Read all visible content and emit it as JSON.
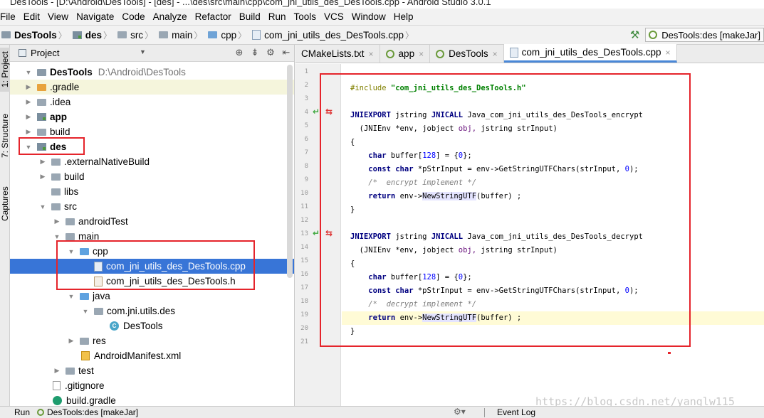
{
  "window": {
    "title": "DesTools - [D:\\Android\\DesTools] - [des] - ...\\des\\src\\main\\cpp\\com_jni_utils_des_DesTools.cpp - Android Studio 3.0.1"
  },
  "menu": [
    "File",
    "Edit",
    "View",
    "Navigate",
    "Code",
    "Analyze",
    "Refactor",
    "Build",
    "Run",
    "Tools",
    "VCS",
    "Window",
    "Help"
  ],
  "breadcrumb": [
    "DesTools",
    "des",
    "src",
    "main",
    "cpp",
    "com_jni_utils_des_DesTools.cpp"
  ],
  "run_config": "DesTools:des [makeJar]",
  "left_tabs": [
    "1: Project",
    "7: Structure",
    "Captures"
  ],
  "project_panel": {
    "title": "Project",
    "tree": [
      {
        "label": "DesTools",
        "path": "D:\\Android\\DesTools"
      },
      {
        "label": ".gradle"
      },
      {
        "label": ".idea"
      },
      {
        "label": "app"
      },
      {
        "label": "build"
      },
      {
        "label": "des"
      },
      {
        "label": ".externalNativeBuild"
      },
      {
        "label": "build"
      },
      {
        "label": "libs"
      },
      {
        "label": "src"
      },
      {
        "label": "androidTest"
      },
      {
        "label": "main"
      },
      {
        "label": "cpp"
      },
      {
        "label": "com_jni_utils_des_DesTools.cpp"
      },
      {
        "label": "com_jni_utils_des_DesTools.h"
      },
      {
        "label": "java"
      },
      {
        "label": "com.jni.utils.des"
      },
      {
        "label": "DesTools"
      },
      {
        "label": "res"
      },
      {
        "label": "AndroidManifest.xml"
      },
      {
        "label": "test"
      },
      {
        "label": ".gitignore"
      },
      {
        "label": "build.gradle"
      }
    ]
  },
  "editor": {
    "tabs": [
      {
        "label": "CMakeLists.txt"
      },
      {
        "label": "app"
      },
      {
        "label": "DesTools"
      },
      {
        "label": "com_jni_utils_des_DesTools.cpp"
      }
    ],
    "line_numbers": [
      "1",
      "2",
      "3",
      "4",
      "5",
      "6",
      "7",
      "8",
      "9",
      "10",
      "11",
      "12",
      "13",
      "14",
      "15",
      "16",
      "17",
      "18",
      "19",
      "20",
      "21"
    ],
    "code": {
      "include_directive": "#include",
      "include_file": "\"com_jni_utils_des_DesTools.h\"",
      "jniexport": "JNIEXPORT",
      "jstring": "jstring",
      "jnicall": "JNICALL",
      "encrypt_fn": "Java_com_jni_utils_des_DesTools_encrypt",
      "decrypt_fn": "Java_com_jni_utils_des_DesTools_decrypt",
      "params_jnienv": "(JNIEnv *env,",
      "params_jobject": "jobject",
      "params_obj": "obj,",
      "params_jstring": "jstring",
      "params_strinput": "strInput)",
      "open_brace": "{",
      "close_brace": "}",
      "char_kw": "char",
      "buffer_decl": "buffer[",
      "buffer_size": "128",
      "buffer_rest": "] = {",
      "zero": "0",
      "buffer_end": "};",
      "const_kw": "const",
      "pstr_decl": "*pStrInput = env->GetStringUTFChars(strInput, ",
      "pstr_end": ");",
      "encrypt_comment": "/*  encrypt implement */",
      "decrypt_comment": "/*  decrypt implement */",
      "return_kw": "return",
      "return_env": "env->",
      "new_string": "NewStringUTF",
      "return_args": "(buffer) ;"
    }
  },
  "statusbar": {
    "run_label": "Run",
    "config": "DesTools:des [makeJar]",
    "event_log": "Event Log"
  },
  "watermark": "https://blog.csdn.net/yanglw115"
}
